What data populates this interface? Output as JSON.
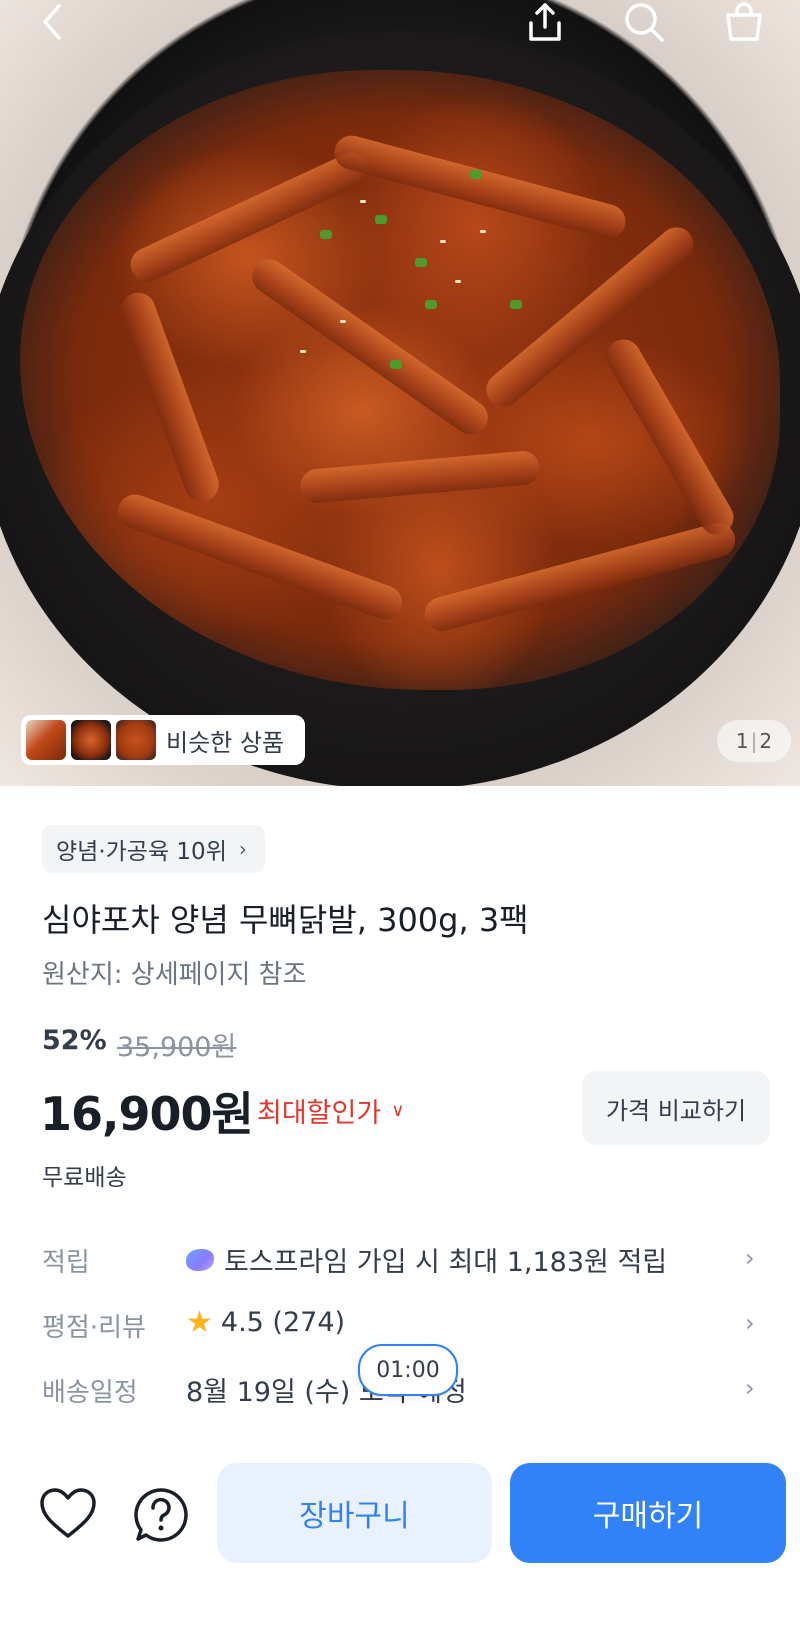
{
  "gallery": {
    "similar_label": "비슷한 상품",
    "page_current": "1",
    "page_total": "2"
  },
  "product": {
    "rank_chip": "양념·가공육 10위",
    "title": "심야포차 양념 무뼈닭발, 300g, 3팩",
    "origin": "원산지: 상세페이지 참조",
    "discount": "52%",
    "original_price": "35,900원",
    "price": "16,900원",
    "max_discount_label": "최대할인가",
    "compare_button": "가격 비교하기",
    "shipping": "무료배송"
  },
  "info_rows": [
    {
      "label": "적립",
      "value": "토스프라임 가입 시 최대 1,183원 적립",
      "icon": "prime-icon"
    },
    {
      "label": "평점·리뷰",
      "value": "4.5 (274)",
      "icon": "star-icon"
    },
    {
      "label": "배송일정",
      "value": "8월 19일 (수) 도착 예정",
      "icon": ""
    }
  ],
  "timer": "01:00",
  "bottom": {
    "cart_label": "장바구니",
    "buy_label": "구매하기"
  },
  "colors": {
    "accent": "#3182f6",
    "discount_red": "#e5362c",
    "cart_bg": "#e8f1fd"
  }
}
